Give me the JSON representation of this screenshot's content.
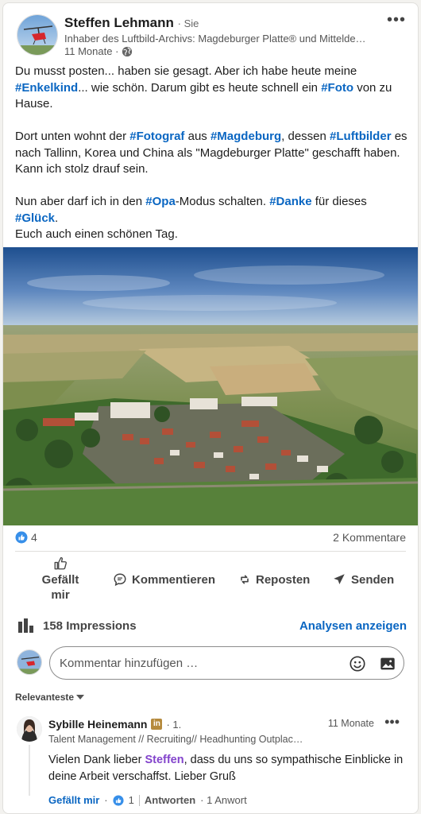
{
  "post": {
    "author": {
      "name": "Steffen Lehmann",
      "you_label": "· Sie",
      "headline": "Inhaber des Luftbild-Archivs: Magdeburger Platte® und Mittelde…",
      "time": "11 Monate ·"
    },
    "text": {
      "p1_a": "Du musst posten... haben sie gesagt. Aber ich habe heute meine ",
      "p1_tag1": "#Enkelkind",
      "p1_b": "... wie schön. Darum gibt es heute schnell ein ",
      "p1_tag2": "#Foto",
      "p1_c": " von zu Hause.",
      "p2_a": "Dort unten wohnt der ",
      "p2_tag1": "#Fotograf",
      "p2_b": " aus ",
      "p2_tag2": "#Magdeburg",
      "p2_c": ", dessen ",
      "p2_tag3": "#Luftbilder",
      "p2_d": " es nach Tallinn, Korea und China als \"Magdeburger Platte\" geschafft haben. Kann ich stolz drauf sein.",
      "p3_a": "Nun aber darf ich in den ",
      "p3_tag1": "#Opa",
      "p3_b": "-Modus schalten. ",
      "p3_tag2": "#Danke",
      "p3_c": " für dieses ",
      "p3_tag3": "#Glück",
      "p3_d": ".",
      "p3_e": "Euch auch einen schönen Tag."
    },
    "likes": "4",
    "comments": "2 Kommentare",
    "actions": {
      "like": "Gefällt mir",
      "comment": "Kommentieren",
      "repost": "Reposten",
      "send": "Senden"
    },
    "impressions": "158 Impressions",
    "analytics_link": "Analysen anzeigen"
  },
  "comment_box": {
    "placeholder": "Kommentar hinzufügen …"
  },
  "sort_label": "Relevanteste",
  "comments_list": [
    {
      "name": "Sybille Heinemann",
      "badge": "in",
      "degree": "· 1.",
      "headline": "Talent Management // Recruiting// Headhunting Outplac…",
      "time": "11 Monate",
      "text_a": "Vielen Dank lieber ",
      "mention": "Steffen",
      "text_b": ", dass du uns so sympathische Einblicke in deine Arbeit verschaffst. Lieber Gruß",
      "like_label": "Gefällt mir",
      "like_sep": "·",
      "like_count": "1",
      "reply_label": "Antworten",
      "reply_count": "· 1 Anwort"
    }
  ],
  "colors": {
    "link": "#0a66c2",
    "mention": "#8344cc"
  }
}
